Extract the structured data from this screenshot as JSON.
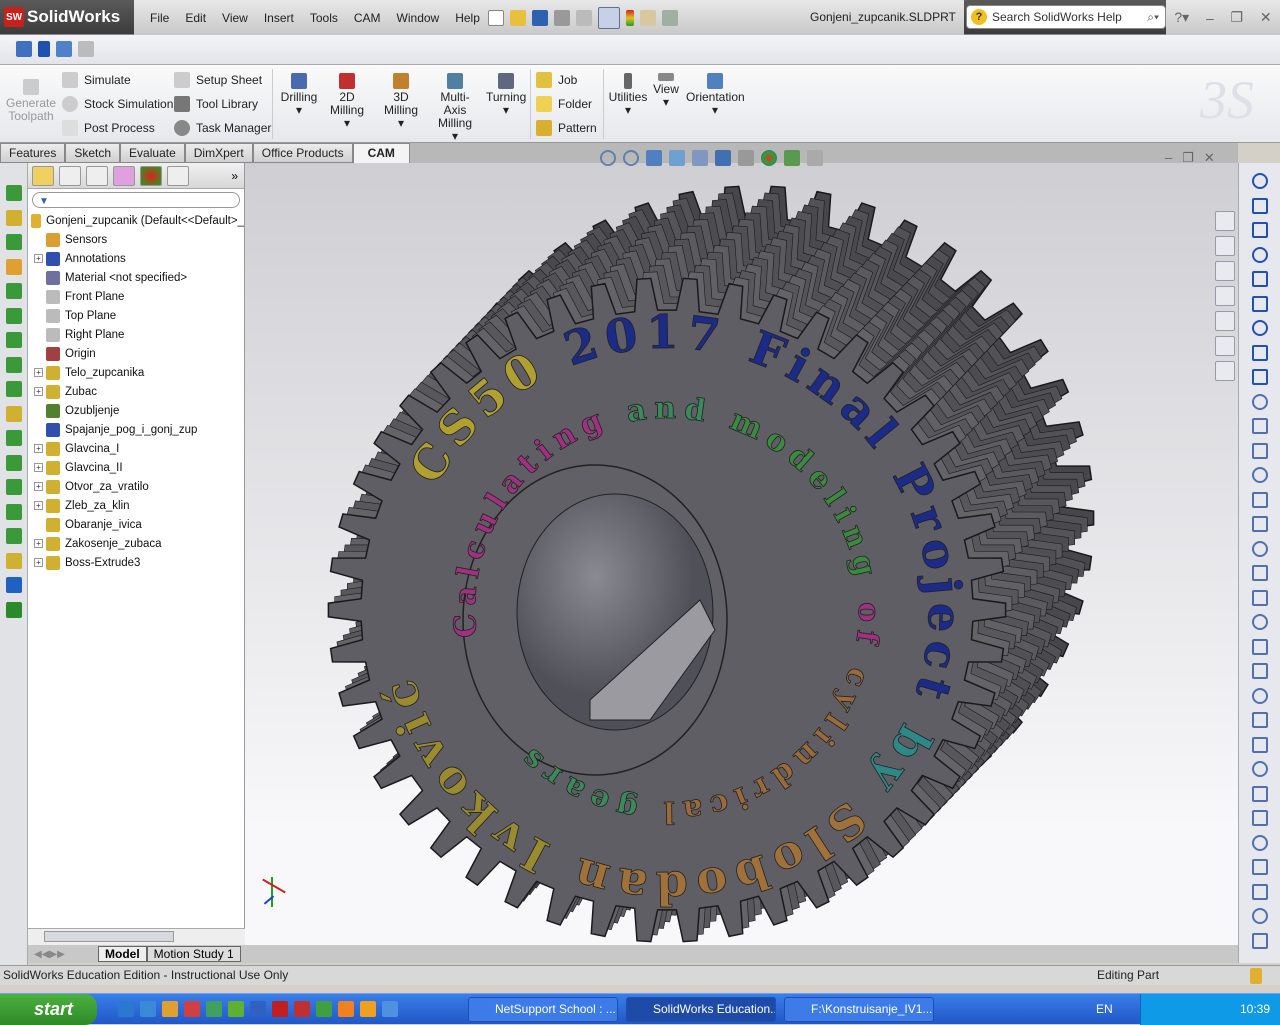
{
  "app": {
    "name": "SolidWorks",
    "document": "Gonjeni_zupcanik.SLDPRT"
  },
  "menu": [
    "File",
    "Edit",
    "View",
    "Insert",
    "Tools",
    "CAM",
    "Window",
    "Help"
  ],
  "search": {
    "placeholder": "Search SolidWorks Help"
  },
  "command_manager": {
    "generate_toolpath": "Generate Toolpath",
    "simulate": "Simulate",
    "stock_simulation": "Stock Simulation",
    "post_process": "Post Process",
    "setup_sheet": "Setup Sheet",
    "tool_library": "Tool Library",
    "task_manager": "Task Manager",
    "drilling": "Drilling",
    "milling_2d": "2D Milling",
    "milling_3d": "3D Milling",
    "multi_axis": "Multi-Axis Milling",
    "turning": "Turning",
    "job": "Job",
    "folder": "Folder",
    "pattern": "Pattern",
    "utilities": "Utilities",
    "view": "View",
    "orientation": "Orientation"
  },
  "tabs": [
    "Features",
    "Sketch",
    "Evaluate",
    "DimXpert",
    "Office Products",
    "CAM"
  ],
  "active_tab": "CAM",
  "feature_tree": {
    "root": "Gonjeni_zupcanik  (Default<<Default>_",
    "items": [
      {
        "label": "Sensors",
        "expand": false,
        "color": "#d8a030"
      },
      {
        "label": "Annotations",
        "expand": true,
        "color": "#3050b0"
      },
      {
        "label": "Material <not specified>",
        "expand": false,
        "color": "#7070a0"
      },
      {
        "label": "Front Plane",
        "expand": false,
        "color": "#bbbbbb"
      },
      {
        "label": "Top Plane",
        "expand": false,
        "color": "#bbbbbb"
      },
      {
        "label": "Right Plane",
        "expand": false,
        "color": "#bbbbbb"
      },
      {
        "label": "Origin",
        "expand": false,
        "color": "#a04040"
      },
      {
        "label": "Telo_zupcanika",
        "expand": true,
        "color": "#d0b030"
      },
      {
        "label": "Zubac",
        "expand": true,
        "color": "#d0b030"
      },
      {
        "label": "Ozubljenje",
        "expand": false,
        "color": "#508030"
      },
      {
        "label": "Spajanje_pog_i_gonj_zup",
        "expand": false,
        "color": "#3050b0"
      },
      {
        "label": "Glavcina_I",
        "expand": true,
        "color": "#d0b030"
      },
      {
        "label": "Glavcina_II",
        "expand": true,
        "color": "#d0b030"
      },
      {
        "label": "Otvor_za_vratilo",
        "expand": true,
        "color": "#d0b030"
      },
      {
        "label": "Zleb_za_klin",
        "expand": true,
        "color": "#d0b030"
      },
      {
        "label": "Obaranje_ivica",
        "expand": false,
        "color": "#d0b030"
      },
      {
        "label": "Zakosenje_zubaca",
        "expand": true,
        "color": "#d0b030"
      },
      {
        "label": "Boss-Extrude3",
        "expand": true,
        "color": "#d0b030"
      }
    ]
  },
  "bottom_tabs": [
    "Model",
    "Motion Study 1"
  ],
  "status": {
    "left": "SolidWorks Education Edition - Instructional Use Only",
    "right": "Editing Part"
  },
  "taskbar": {
    "start": "start",
    "tasks": [
      "NetSupport School : ...",
      "SolidWorks Education...",
      "F:\\Konstruisanje_IV1..."
    ],
    "language": "EN",
    "clock": "10:39"
  },
  "model_text": {
    "outer": [
      {
        "text": "CS50",
        "color": "#b0a030"
      },
      {
        "text": "2017",
        "color": "#1c2a88"
      },
      {
        "text": "Final",
        "color": "#1c2a88"
      },
      {
        "text": "Project",
        "color": "#1c2a88"
      },
      {
        "text": "by",
        "color": "#2e8888"
      },
      {
        "text": "Slobodan",
        "color": "#a0723a"
      },
      {
        "text": "Ivković",
        "color": "#9a8a30"
      }
    ],
    "inner": [
      {
        "text": "Calculating",
        "color": "#a03080"
      },
      {
        "text": "and",
        "color": "#3a8a5a"
      },
      {
        "text": "modeling",
        "color": "#3a8a40"
      },
      {
        "text": "of",
        "color": "#a03080"
      },
      {
        "text": "cylindrical",
        "color": "#9a6a3a"
      },
      {
        "text": "gears",
        "color": "#3a8a5a"
      }
    ]
  },
  "colors": {
    "gear_face": "#5e5e64",
    "gear_side": "#46464c",
    "accent_red": "#c8201a"
  }
}
